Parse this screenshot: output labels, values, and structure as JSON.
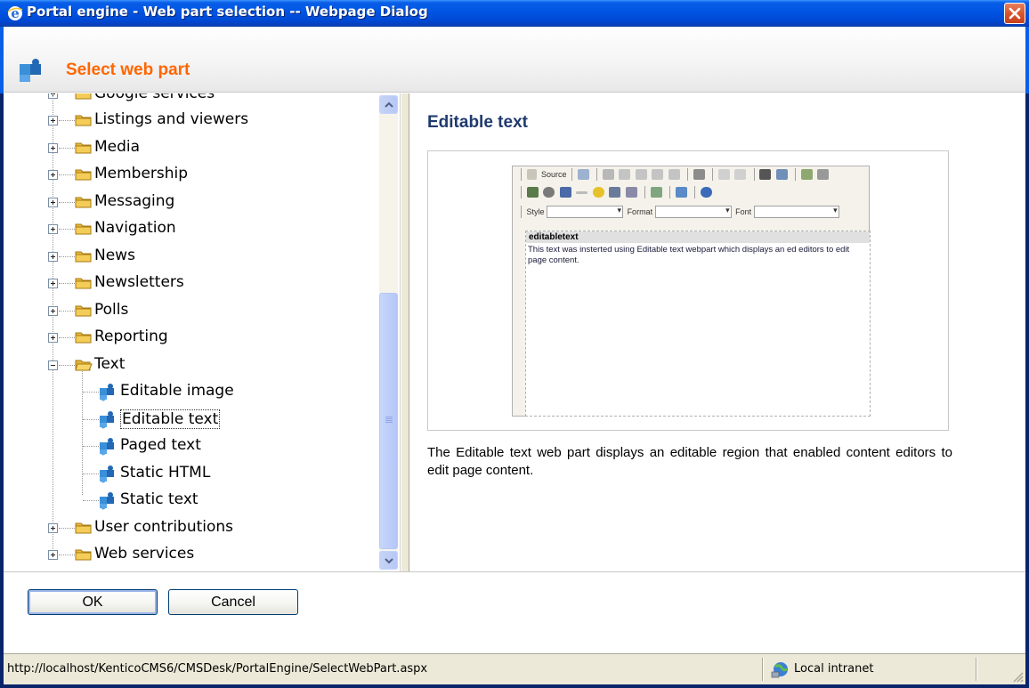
{
  "window": {
    "title": "Portal engine - Web part selection -- Webpage Dialog"
  },
  "header": {
    "title": "Select web part"
  },
  "tree": {
    "partial_top_label": "Google services",
    "items": [
      {
        "label": "Listings and viewers",
        "type": "folder",
        "state": "collapsed"
      },
      {
        "label": "Media",
        "type": "folder",
        "state": "collapsed"
      },
      {
        "label": "Membership",
        "type": "folder",
        "state": "collapsed"
      },
      {
        "label": "Messaging",
        "type": "folder",
        "state": "collapsed"
      },
      {
        "label": "Navigation",
        "type": "folder",
        "state": "collapsed"
      },
      {
        "label": "News",
        "type": "folder",
        "state": "collapsed"
      },
      {
        "label": "Newsletters",
        "type": "folder",
        "state": "collapsed"
      },
      {
        "label": "Polls",
        "type": "folder",
        "state": "collapsed"
      },
      {
        "label": "Reporting",
        "type": "folder",
        "state": "collapsed"
      },
      {
        "label": "Text",
        "type": "folder",
        "state": "expanded"
      },
      {
        "label": "Editable image",
        "type": "webpart",
        "state": "leaf"
      },
      {
        "label": "Editable text",
        "type": "webpart",
        "state": "selected"
      },
      {
        "label": "Paged text",
        "type": "webpart",
        "state": "leaf"
      },
      {
        "label": "Static HTML",
        "type": "webpart",
        "state": "leaf"
      },
      {
        "label": "Static text",
        "type": "webpart",
        "state": "leaf"
      },
      {
        "label": "User contributions",
        "type": "folder",
        "state": "collapsed"
      },
      {
        "label": "Web services",
        "type": "folder",
        "state": "collapsed"
      }
    ]
  },
  "detail": {
    "title": "Editable text",
    "preview": {
      "source_label": "Source",
      "style_label": "Style",
      "format_label": "Format",
      "font_label": "Font",
      "region_name": "editabletext",
      "region_text": "This text was insterted using Editable text webpart which displays an ed editors to edit page content."
    },
    "description": "The Editable text web part displays an editable region that enabled content editors to edit page content."
  },
  "buttons": {
    "ok": "OK",
    "cancel": "Cancel"
  },
  "statusbar": {
    "url": "http://localhost/KenticoCMS6/CMSDesk/PortalEngine/SelectWebPart.aspx",
    "zone": "Local intranet"
  },
  "colors": {
    "title_bar": "#0054e3",
    "heading_accent": "#ff6600",
    "detail_title": "#1f3a6e",
    "selection_border": "#333333"
  }
}
